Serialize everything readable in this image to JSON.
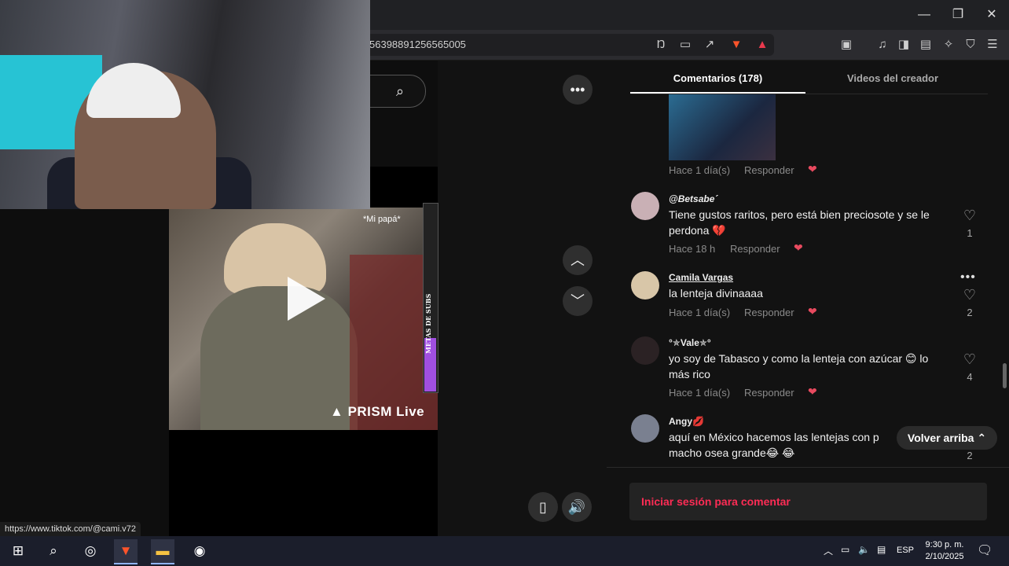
{
  "window": {
    "minimize_glyph": "—",
    "restore_glyph": "❐",
    "close_glyph": "✕"
  },
  "address_bar": {
    "url": "56398891256565005"
  },
  "toolbar_icons": [
    "translate-off-icon",
    "cast-icon",
    "share-icon",
    "brave-shields-icon",
    "brave-rewards-icon",
    "reader-mode-icon",
    "music-icon",
    "sidebar-icon",
    "wallet-icon",
    "leo-ai-icon",
    "vpn-icon",
    "menu-icon"
  ],
  "video": {
    "caption": "*Mi papá*",
    "watermark": "PRISM Live",
    "goal_label": "METAS DE SUBS"
  },
  "tabs": {
    "comments": "Comentarios (178)",
    "creator_videos": "Videos del creador"
  },
  "comments": [
    {
      "time": "Hace 1 día(s)",
      "reply": "Responder"
    },
    {
      "user": "@Betsabe´",
      "text": "Tiene gustos raritos, pero está bien preciosote y se le perdona 💔",
      "time": "Hace 18 h",
      "reply": "Responder",
      "likes": "1"
    },
    {
      "user": "Camila Vargas",
      "text": "la lenteja divinaaaa",
      "time": "Hace 1 día(s)",
      "reply": "Responder",
      "likes": "2"
    },
    {
      "user": "°✯Vale✯°",
      "text": "yo soy de Tabasco y como la lenteja con azúcar 😊 lo más rico",
      "time": "Hace 1 día(s)",
      "reply": "Responder",
      "likes": "4"
    },
    {
      "user": "Angy💋",
      "text": "aquí en México hacemos las lentejas con p",
      "text2": "macho osea grande😂 😂",
      "likes": "2"
    }
  ],
  "back_to_top": "Volver arriba",
  "login_prompt": "Iniciar sesión para comentar",
  "status_url": "https://www.tiktok.com/@cami.v72",
  "taskbar": {
    "language": "ESP",
    "time": "9:30 p. m.",
    "date": "2/10/2025"
  },
  "colors": {
    "accent_red": "#fe2c55",
    "panel_bg": "#121212",
    "goal_fill": "#a04fe0"
  }
}
